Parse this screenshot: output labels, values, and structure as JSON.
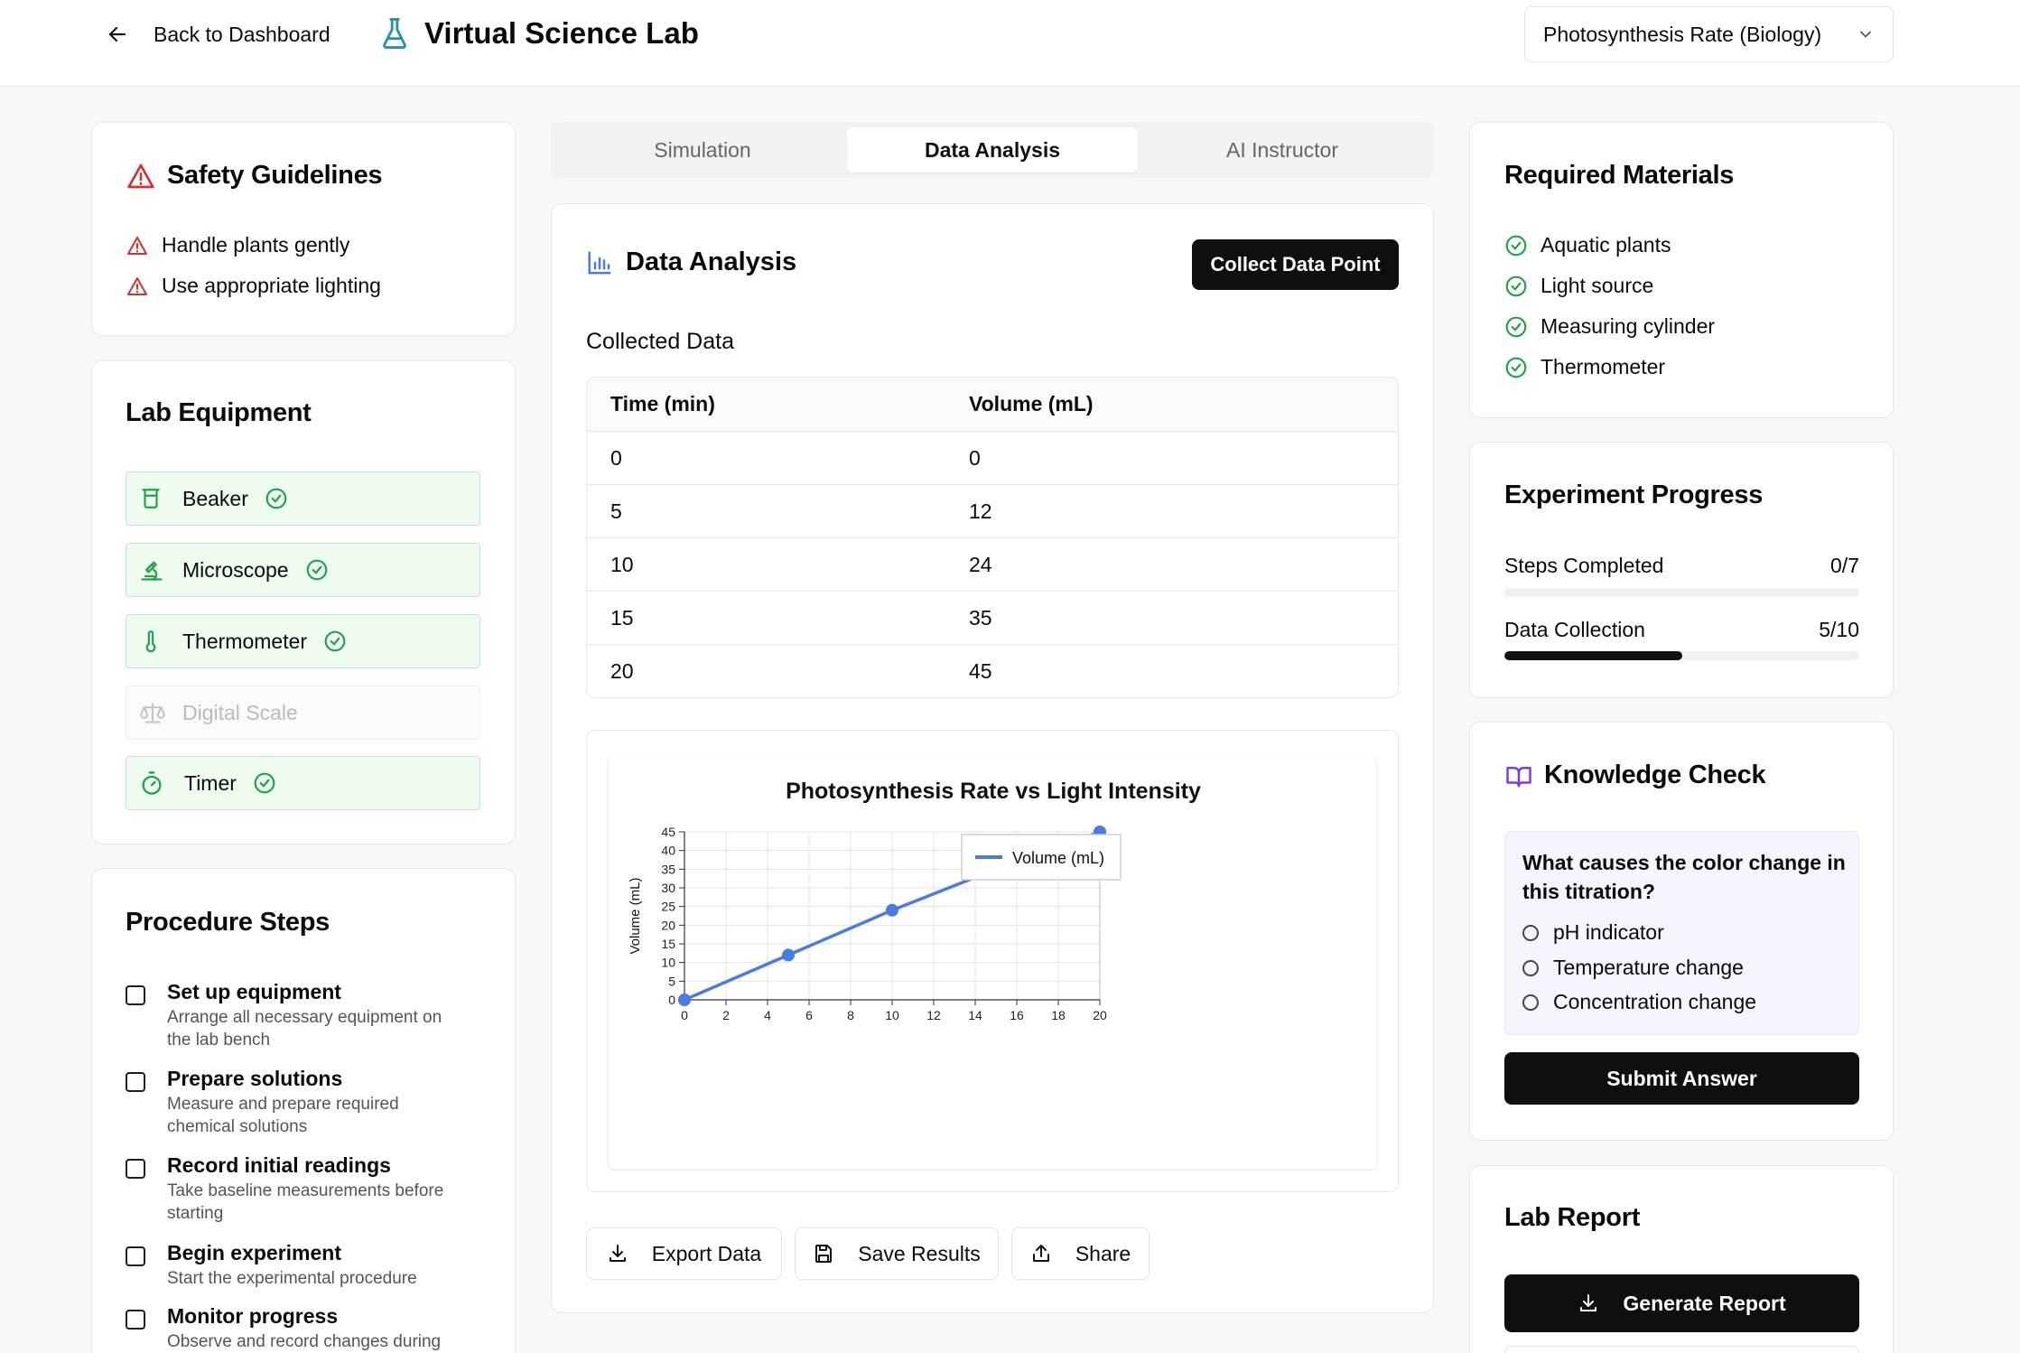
{
  "header": {
    "back_label": "Back to Dashboard",
    "app_title": "Virtual Science Lab",
    "experiment_select": "Photosynthesis Rate (Biology)"
  },
  "safety": {
    "title": "Safety Guidelines",
    "items": [
      "Handle plants gently",
      "Use appropriate lighting"
    ]
  },
  "equipment": {
    "title": "Lab Equipment",
    "items": [
      {
        "label": "Beaker",
        "icon": "beaker-icon",
        "available": true
      },
      {
        "label": "Microscope",
        "icon": "microscope-icon",
        "available": true
      },
      {
        "label": "Thermometer",
        "icon": "thermometer-icon",
        "available": true
      },
      {
        "label": "Digital Scale",
        "icon": "scale-icon",
        "available": false
      },
      {
        "label": "Timer",
        "icon": "timer-icon",
        "available": true
      }
    ]
  },
  "procedure": {
    "title": "Procedure Steps",
    "steps": [
      {
        "title": "Set up equipment",
        "desc1": "Arrange all necessary equipment on",
        "desc2": "the lab bench"
      },
      {
        "title": "Prepare solutions",
        "desc1": "Measure and prepare required",
        "desc2": "chemical solutions"
      },
      {
        "title": "Record initial readings",
        "desc1": "Take baseline measurements before",
        "desc2": "starting"
      },
      {
        "title": "Begin experiment",
        "desc1": "Start the experimental procedure",
        "desc2": ""
      },
      {
        "title": "Monitor progress",
        "desc1": "Observe and record changes during",
        "desc2": ""
      }
    ]
  },
  "tabs": [
    "Simulation",
    "Data Analysis",
    "AI Instructor"
  ],
  "analysis": {
    "title": "Data Analysis",
    "collect_button": "Collect Data Point",
    "collected_title": "Collected Data",
    "columns": [
      "Time (min)",
      "Volume (mL)"
    ],
    "rows": [
      [
        "0",
        "0"
      ],
      [
        "5",
        "12"
      ],
      [
        "10",
        "24"
      ],
      [
        "15",
        "35"
      ],
      [
        "20",
        "45"
      ]
    ],
    "export_button": "Export Data",
    "save_button": "Save Results",
    "share_button": "Share"
  },
  "chart_data": {
    "type": "line",
    "title": "Photosynthesis Rate vs Light Intensity",
    "xlabel": "",
    "ylabel": "Volume (mL)",
    "x": [
      0,
      5,
      10,
      15,
      20
    ],
    "series": [
      {
        "name": "Volume (mL)",
        "values": [
          0,
          12,
          24,
          35,
          45
        ],
        "color": "#4a7ae3"
      }
    ],
    "xlim": [
      0,
      20
    ],
    "ylim": [
      0,
      45
    ],
    "xticks": [
      "0",
      "2",
      "4",
      "6",
      "8",
      "10",
      "12",
      "14",
      "16",
      "18",
      "20"
    ],
    "yticks": [
      "0",
      "5",
      "10",
      "15",
      "20",
      "25",
      "30",
      "35",
      "40",
      "45"
    ],
    "grid": true,
    "legend": "top-right"
  },
  "materials": {
    "title": "Required Materials",
    "items": [
      "Aquatic plants",
      "Light source",
      "Measuring cylinder",
      "Thermometer"
    ]
  },
  "progress": {
    "title": "Experiment Progress",
    "steps_label": "Steps Completed",
    "steps_value": "0/7",
    "steps_fraction": 0,
    "data_label": "Data Collection",
    "data_value": "5/10",
    "data_fraction": 0.5
  },
  "quiz": {
    "title": "Knowledge Check",
    "question_line1": "What causes the color change in",
    "question_line2": "this titration?",
    "options": [
      "pH indicator",
      "Temperature change",
      "Concentration change"
    ],
    "submit": "Submit Answer"
  },
  "report": {
    "title": "Lab Report",
    "generate": "Generate Report"
  },
  "colors": {
    "accent": "#0f0f10",
    "success": "#22a148",
    "danger": "#d62f2f",
    "chart": "#4a7ae3",
    "purple": "#7c3aed",
    "flask": "#2a8fa8"
  }
}
